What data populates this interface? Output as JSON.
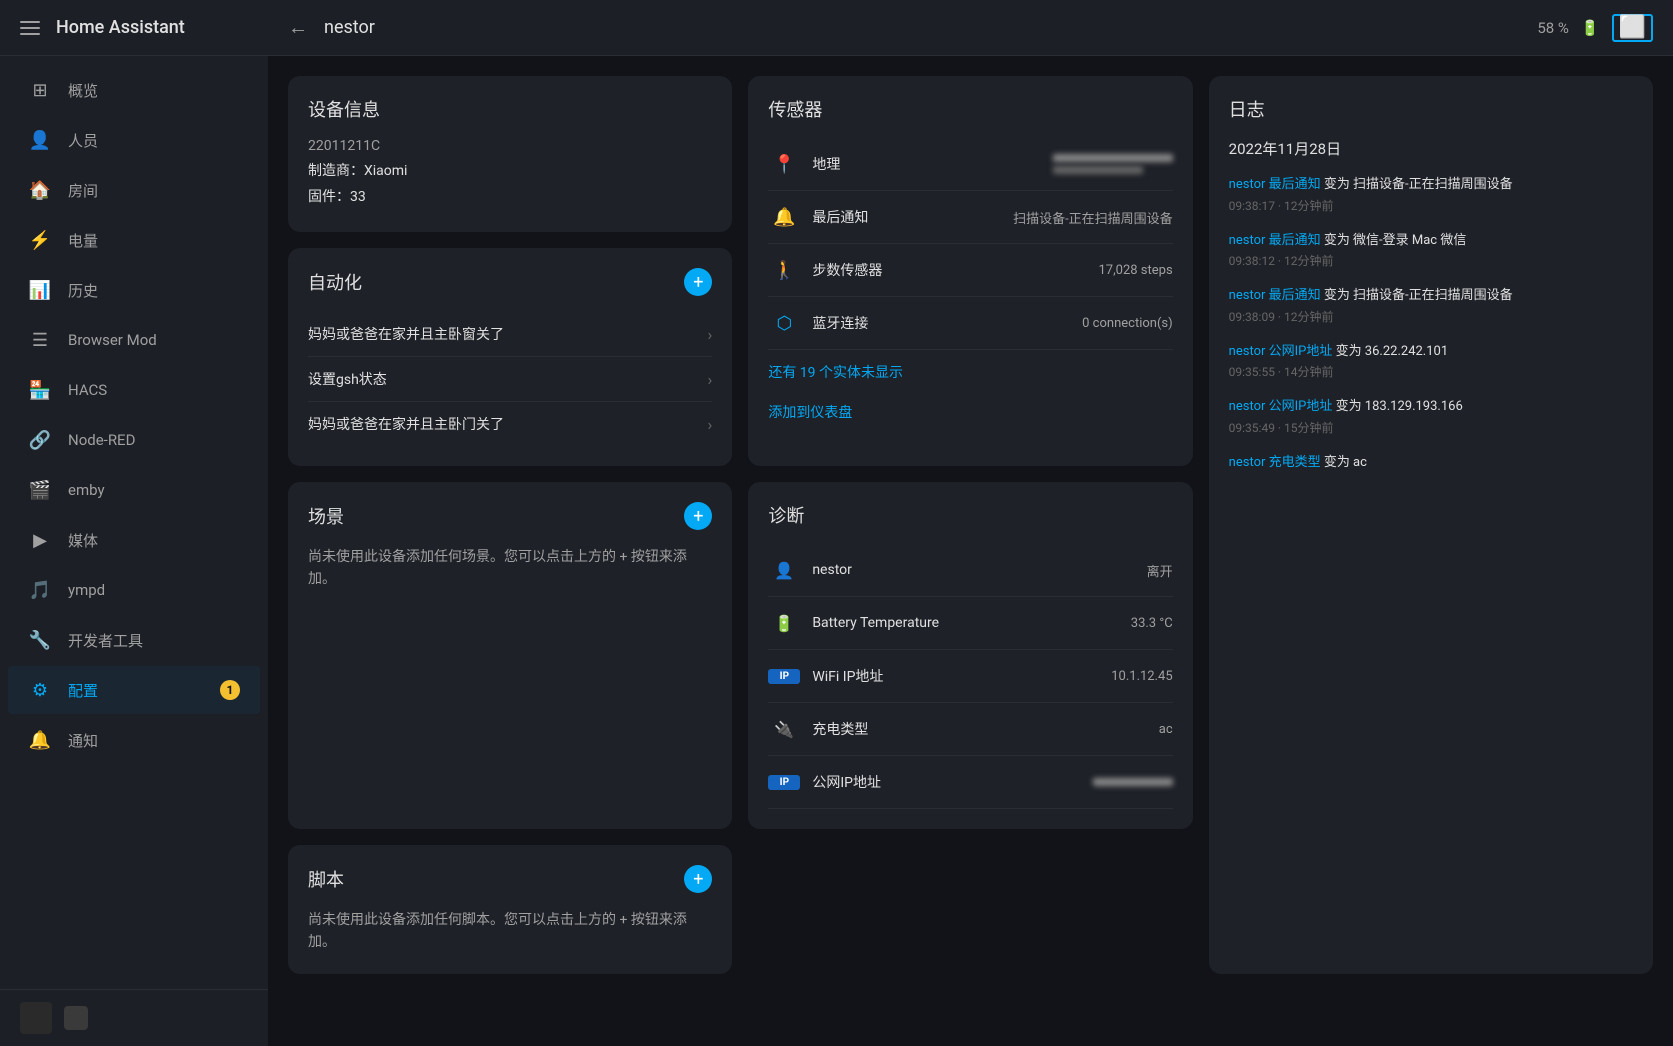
{
  "sidebar": {
    "app_title": "Home Assistant",
    "menu_icon": "menu",
    "items": [
      {
        "id": "overview",
        "label": "概览",
        "icon": "⊞",
        "active": false
      },
      {
        "id": "people",
        "label": "人员",
        "icon": "👤",
        "active": false
      },
      {
        "id": "rooms",
        "label": "房间",
        "icon": "🏠",
        "active": false
      },
      {
        "id": "energy",
        "label": "电量",
        "icon": "⚡",
        "active": false
      },
      {
        "id": "history",
        "label": "历史",
        "icon": "📊",
        "active": false
      },
      {
        "id": "browser-mod",
        "label": "Browser Mod",
        "icon": "☰",
        "active": false
      },
      {
        "id": "hacs",
        "label": "HACS",
        "icon": "🏪",
        "active": false
      },
      {
        "id": "node-red",
        "label": "Node-RED",
        "icon": "🔗",
        "active": false
      },
      {
        "id": "emby",
        "label": "emby",
        "icon": "🎬",
        "active": false
      },
      {
        "id": "media",
        "label": "媒体",
        "icon": "▶",
        "active": false
      },
      {
        "id": "ympd",
        "label": "ympd",
        "icon": "🎵",
        "active": false
      },
      {
        "id": "developer",
        "label": "开发者工具",
        "icon": "🔧",
        "active": false
      },
      {
        "id": "config",
        "label": "配置",
        "icon": "⚙",
        "active": true,
        "badge": "1"
      },
      {
        "id": "notifications",
        "label": "通知",
        "icon": "🔔",
        "active": false
      }
    ]
  },
  "topbar": {
    "back_label": "←",
    "title": "nestor",
    "battery_pct": "58 %",
    "battery_icon": "🔋",
    "tablet_icon": "⬜"
  },
  "device_info": {
    "title": "设备信息",
    "id": "22011211C",
    "manufacturer_label": "制造商：",
    "manufacturer": "Xiaomi",
    "firmware_label": "固件：",
    "firmware": "33"
  },
  "sensors": {
    "title": "传感器",
    "items": [
      {
        "icon": "📍",
        "name": "地理",
        "value": "浙江省杭...",
        "blurred": true
      },
      {
        "icon": "🔔",
        "name": "最后通知",
        "value": "扫描设备-正在扫描周围设备",
        "blurred": false
      },
      {
        "icon": "🚶",
        "name": "步数传感器",
        "value": "17,028 steps",
        "blurred": false
      },
      {
        "icon": "bluetooth",
        "name": "蓝牙连接",
        "value": "0 connection(s)",
        "blurred": false
      }
    ],
    "more_label": "还有 19 个实体未显示",
    "add_label": "添加到仪表盘"
  },
  "automation": {
    "title": "自动化",
    "add_btn": "+",
    "items": [
      {
        "name": "妈妈或爸爸在家并且主卧窗关了"
      },
      {
        "name": "设置gsh状态"
      },
      {
        "name": "妈妈或爸爸在家并且主卧门关了"
      }
    ]
  },
  "scene": {
    "title": "场景",
    "add_btn": "+",
    "desc": "尚未使用此设备添加任何场景。您可以点击上方的 + 按钮来添加。"
  },
  "script": {
    "title": "脚本",
    "add_btn": "+",
    "desc": "尚未使用此设备添加任何脚本。您可以点击上方的 + 按钮来添加。"
  },
  "log": {
    "title": "日志",
    "date": "2022年11月28日",
    "entries": [
      {
        "link_text": "nestor 最后通知",
        "rest": " 变为 扫描设备-正在扫描周围设备",
        "time": "09:38:17 · 12分钟前"
      },
      {
        "link_text": "nestor 最后通知",
        "rest": " 变为 微信-登录 Mac 微信",
        "time": "09:38:12 · 12分钟前"
      },
      {
        "link_text": "nestor 最后通知",
        "rest": " 变为 扫描设备-正在扫描周围设备",
        "time": "09:38:09 · 12分钟前"
      },
      {
        "link_text": "nestor 公网IP地址",
        "rest": " 变为 36.22.242.101",
        "time": "09:35:55 · 14分钟前"
      },
      {
        "link_text": "nestor 公网IP地址",
        "rest": " 变为 183.129.193.166",
        "time": "09:35:49 · 15分钟前"
      },
      {
        "link_text": "nestor 充电类型",
        "rest": " 变为 ac",
        "time": ""
      }
    ]
  },
  "diagnostics": {
    "title": "诊断",
    "items": [
      {
        "icon": "person",
        "name": "nestor",
        "value": "离开"
      },
      {
        "icon": "battery",
        "name": "Battery Temperature",
        "value": "33.3 °C"
      },
      {
        "icon": "ip",
        "name": "WiFi IP地址",
        "value": "10.1.12.45"
      },
      {
        "icon": "charge",
        "name": "充电类型",
        "value": "ac"
      },
      {
        "icon": "ip",
        "name": "公网IP地址",
        "value": "..."
      }
    ]
  },
  "colors": {
    "accent": "#03a9f4",
    "bg_dark": "#111318",
    "bg_card": "#1e2128",
    "bg_sidebar": "#1c1f26",
    "text_primary": "#e0e0e0",
    "text_secondary": "#a0a0a0",
    "badge_color": "#f4c030"
  }
}
